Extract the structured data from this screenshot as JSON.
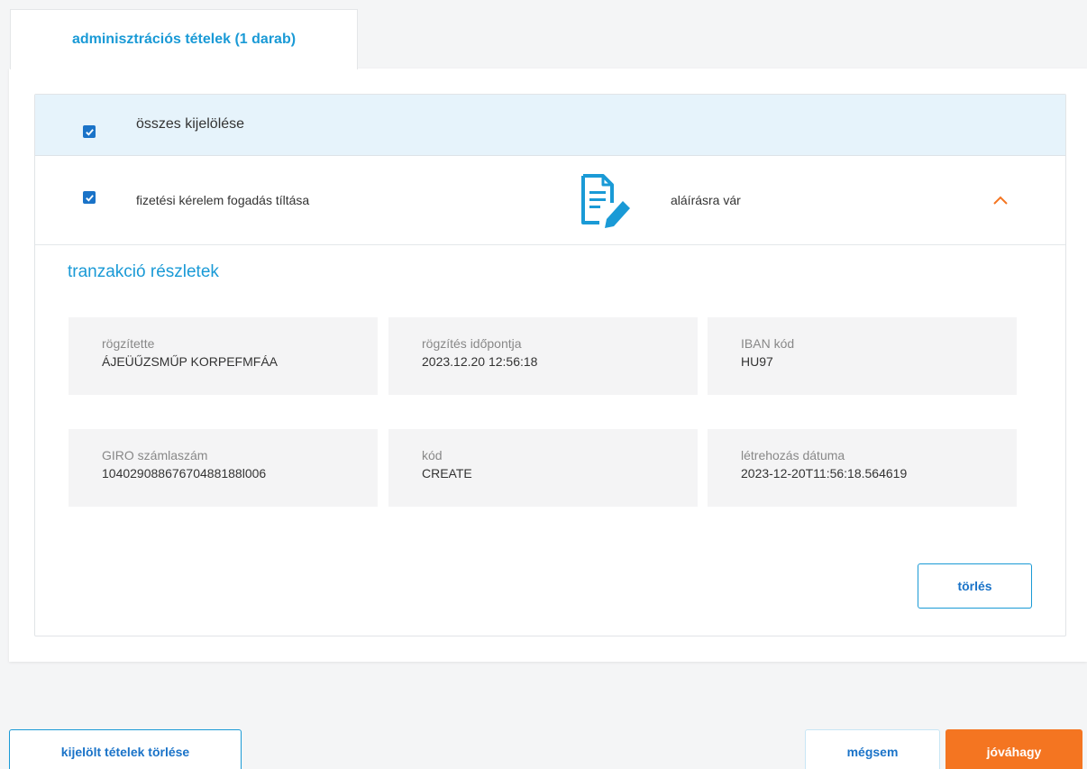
{
  "tab": {
    "label": "adminisztrációs tételek (1 darab)"
  },
  "select_all": {
    "label": "összes kijelölése",
    "checked": true
  },
  "item": {
    "checked": true,
    "title": "fizetési kérelem fogadás tíltása",
    "status_icon": "document-edit-icon",
    "status": "aláírásra vár",
    "toggle_icon": "chevron-up-icon"
  },
  "details": {
    "title": "tranzakció részletek",
    "fields": [
      {
        "label": "rögzítette",
        "value": "ÁJEÜŰZSMŰP KORPEFMFÁA"
      },
      {
        "label": "rögzítés időpontja",
        "value": "2023.12.20 12:56:18"
      },
      {
        "label": "IBAN kód",
        "value": "HU97"
      },
      {
        "label": "GIRO számlaszám",
        "value": "10402908867670488188l006"
      },
      {
        "label": "kód",
        "value": "CREATE"
      },
      {
        "label": "létrehozás dátuma",
        "value": "2023-12-20T11:56:18.564619"
      }
    ],
    "delete_label": "törlés"
  },
  "footer": {
    "delete_selected_label": "kijelölt tételek törlése",
    "cancel_label": "mégsem",
    "approve_label": "jóváhagy"
  },
  "colors": {
    "accent": "#1a9ad6",
    "checkbox": "#1a73c8",
    "primary_action": "#f47521",
    "header_bg": "#e6f3fb"
  }
}
